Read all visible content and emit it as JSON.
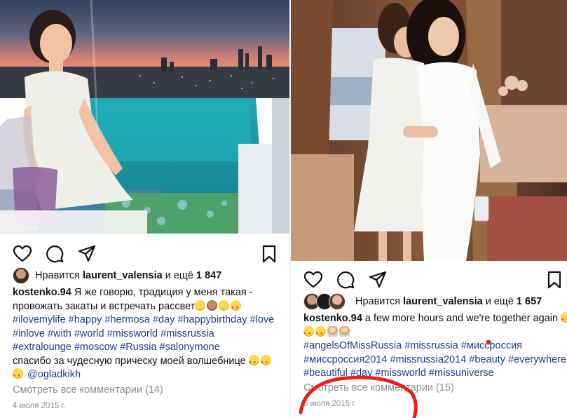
{
  "post1": {
    "liked_by": "laurent_valensia",
    "likes_prefix": "Нравится",
    "likes_mid": "и ещё",
    "likes_count": "1 847",
    "username": "kostenko.94",
    "caption_line1": "Я же говорю, традиция у меня такая -",
    "caption_line2": "провожать закаты и встречать рассвет",
    "hashtags_line1": "#ilovemylife #happy #hermosa #day #happybirthday #love",
    "hashtags_line2": "#inlove #with #world #missworld #missrussia",
    "hashtags_line3": "#extralounge #moscow #Russia #salonymone",
    "caption_line3": "спасибо за чудесную прическу моей волшебнице",
    "mention": "@ogladkikh",
    "view_comments": "Смотреть все комментарии (14)",
    "date": "4 июля 2015 г."
  },
  "post2": {
    "liked_by": "laurent_valensia",
    "likes_prefix": "Нравится",
    "likes_mid": "и ещё",
    "likes_count": "1 657",
    "username": "kostenko.94",
    "caption_line1": "a few more hours and we're together again",
    "hashtags_line1": "#angelsOfMissRussia #missrussia #мисcроссия",
    "hashtags_line2": "#миссроссия2014 #missrussia2014 #beauty #everywhere",
    "hashtags_line3": "#beautiful #day #missworld #missuniverse",
    "view_comments": "Смотреть все комментарии (15)",
    "date": "6 июля 2015 г."
  },
  "icons": [
    "heart-icon",
    "comment-icon",
    "share-icon",
    "bookmark-icon"
  ],
  "colors": {
    "hashtag": "#1d3f8f",
    "annotation": "#e8201c",
    "muted": "#8e8e8e"
  }
}
